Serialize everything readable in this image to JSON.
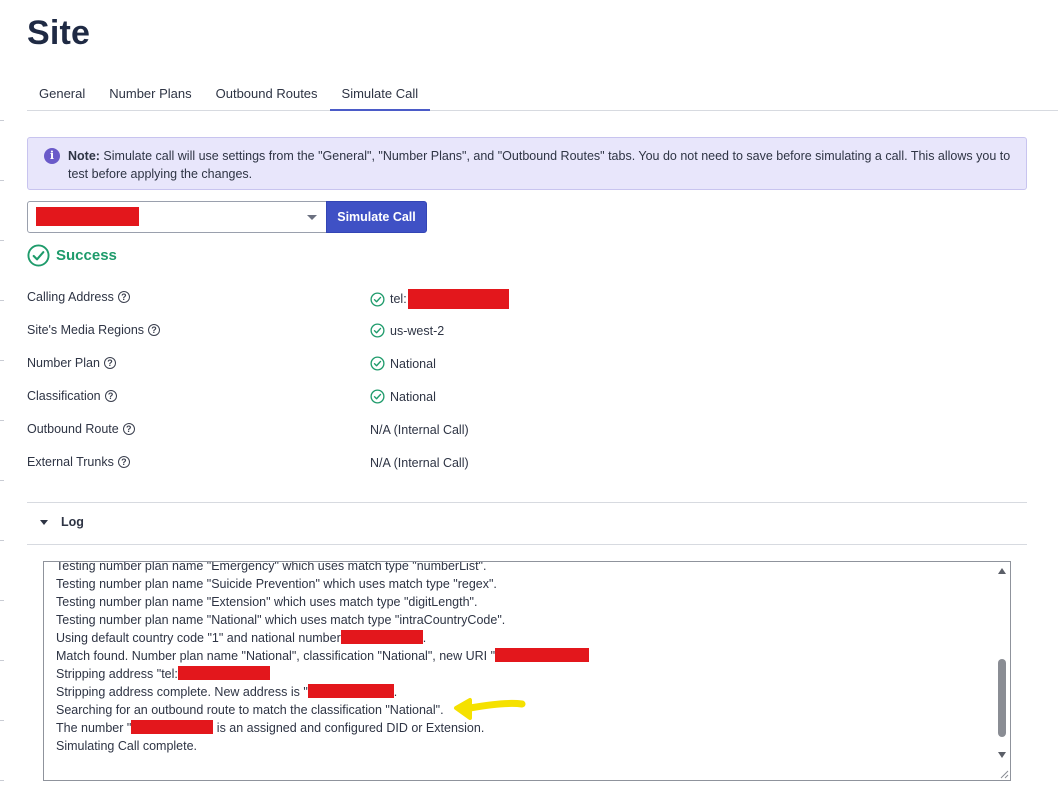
{
  "page": {
    "title": "Site"
  },
  "tabs": [
    {
      "label": "General",
      "active": false
    },
    {
      "label": "Number Plans",
      "active": false
    },
    {
      "label": "Outbound Routes",
      "active": false
    },
    {
      "label": "Simulate Call",
      "active": true
    }
  ],
  "note": {
    "prefix": "Note:",
    "text": " Simulate call will use settings from the \"General\", \"Number Plans\", and \"Outbound Routes\" tabs. You do not need to save before simulating a call. This allows you to test before applying the changes."
  },
  "simulate": {
    "button_label": "Simulate Call",
    "status": "Success"
  },
  "results": [
    {
      "label": "Calling Address",
      "value": "tel:",
      "check": true
    },
    {
      "label": "Site's Media Regions",
      "value": "us-west-2",
      "check": true
    },
    {
      "label": "Number Plan",
      "value": "National",
      "check": true
    },
    {
      "label": "Classification",
      "value": "National",
      "check": true
    },
    {
      "label": "Outbound Route",
      "value": "N/A (Internal Call)",
      "check": false
    },
    {
      "label": "External Trunks",
      "value": "N/A (Internal Call)",
      "check": false
    }
  ],
  "log": {
    "title": "Log",
    "lines": [
      "Testing number plan name \"Emergency\" which uses match type \"numberList\".",
      "Testing number plan name \"Suicide Prevention\" which uses match type \"regex\".",
      "Testing number plan name \"Extension\" which uses match type \"digitLength\".",
      "Testing number plan name \"National\" which uses match type \"intraCountryCode\".",
      "Using default country code \"1\" and national number",
      "Match found. Number plan name \"National\", classification \"National\", new URI \"",
      "Stripping address \"tel:",
      "Stripping address complete. New address is \"",
      "Searching for an outbound route to match the classification \"National\".",
      "The number \"",
      "Simulating Call complete."
    ],
    "line_suffixes": {
      "4": ".",
      "7": ".",
      "9": " is an assigned and configured DID or Extension."
    }
  },
  "colors": {
    "accent": "#3f51c5",
    "success": "#1e9b6b",
    "note_bg": "#e8e6fb",
    "redaction": "#e3171c",
    "annotation": "#f5e100"
  }
}
